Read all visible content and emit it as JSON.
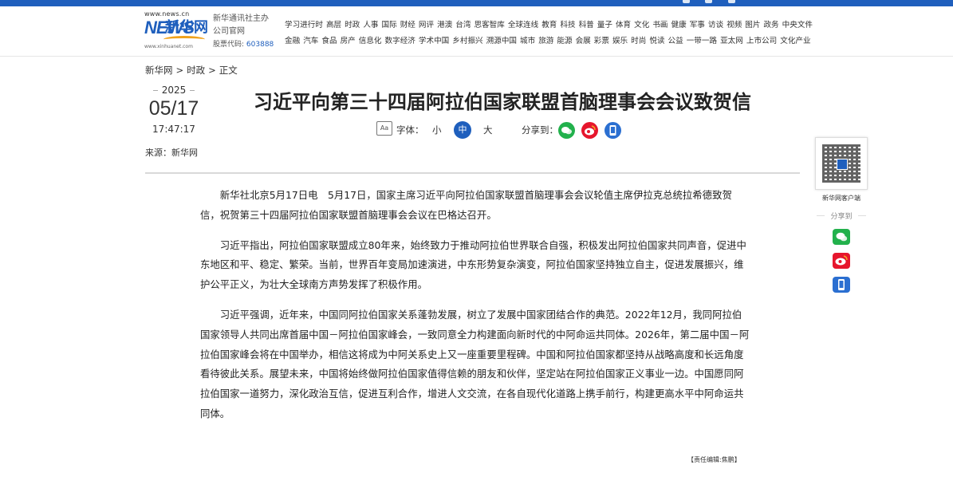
{
  "header": {
    "logo": {
      "url": "www.news.cn",
      "news_text": "NEWS",
      "cn_text": "新华网",
      "url_small": "www.xinhuanet.com"
    },
    "org": {
      "line1": "新华通讯社主办",
      "line2": "公司官网",
      "stock_label": "股票代码:",
      "stock_code": "603888"
    },
    "nav_row1": [
      "学习进行时",
      "高层",
      "时政",
      "人事",
      "国际",
      "财经",
      "网评",
      "港澳",
      "台湾",
      "思客智库",
      "全球连线",
      "教育",
      "科技",
      "科普",
      "量子",
      "体育",
      "文化",
      "书画",
      "健康",
      "军事",
      "访谈",
      "视频",
      "图片",
      "政务",
      "中央文件"
    ],
    "nav_row2": [
      "金融",
      "汽车",
      "食品",
      "房产",
      "信息化",
      "数字经济",
      "学术中国",
      "乡村振兴",
      "溯源中国",
      "城市",
      "旅游",
      "能源",
      "会展",
      "彩票",
      "娱乐",
      "时尚",
      "悦读",
      "公益",
      "一带一路",
      "亚太网",
      "上市公司",
      "文化产业"
    ]
  },
  "breadcrumb": {
    "home": "新华网",
    "sep1": ">",
    "section": "时政",
    "sep2": ">",
    "current": "正文"
  },
  "date": {
    "year": "2025",
    "month_day": "05/17",
    "time": "17:47:17"
  },
  "source": "来源：新华网",
  "title": "习近平向第三十四届阿拉伯国家联盟首脑理事会会议致贺信",
  "tools": {
    "font_icon": "Aa",
    "font_label": "字体：",
    "small": "小",
    "medium": "中",
    "large": "大",
    "share_label": "分享到："
  },
  "article": {
    "p1": "新华社北京5月17日电　5月17日，国家主席习近平向阿拉伯国家联盟首脑理事会会议轮值主席伊拉克总统拉希德致贺信，祝贺第三十四届阿拉伯国家联盟首脑理事会会议在巴格达召开。",
    "p2": "习近平指出，阿拉伯国家联盟成立80年来，始终致力于推动阿拉伯世界联合自强，积极发出阿拉伯国家共同声音，促进中东地区和平、稳定、繁荣。当前，世界百年变局加速演进，中东形势复杂演变，阿拉伯国家坚持独立自主，促进发展振兴，维护公平正义，为壮大全球南方声势发挥了积极作用。",
    "p3": "习近平强调，近年来，中国同阿拉伯国家关系蓬勃发展，树立了发展中国家团结合作的典范。2022年12月，我同阿拉伯国家领导人共同出席首届中国－阿拉伯国家峰会，一致同意全力构建面向新时代的中阿命运共同体。2026年，第二届中国－阿拉伯国家峰会将在中国举办，相信这将成为中阿关系史上又一座重要里程碑。中国和阿拉伯国家都坚持从战略高度和长远角度看待彼此关系。展望未来，中国将始终做阿拉伯国家值得信赖的朋友和伙伴，坚定站在阿拉伯国家正义事业一边。中国愿同阿拉伯国家一道努力，深化政治互信，促进互利合作，增进人文交流，在各自现代化道路上携手前行，构建更高水平中阿命运共同体。"
  },
  "editor": "【责任编辑:焦鹏】",
  "sidebar": {
    "qr_label": "新华网客户端",
    "share_label": "分享到"
  },
  "colors": {
    "brand_blue": "#1f5fbd",
    "wechat_green": "#22b14c",
    "weibo_red": "#e6162d",
    "mobile_blue": "#2b6fd1"
  }
}
